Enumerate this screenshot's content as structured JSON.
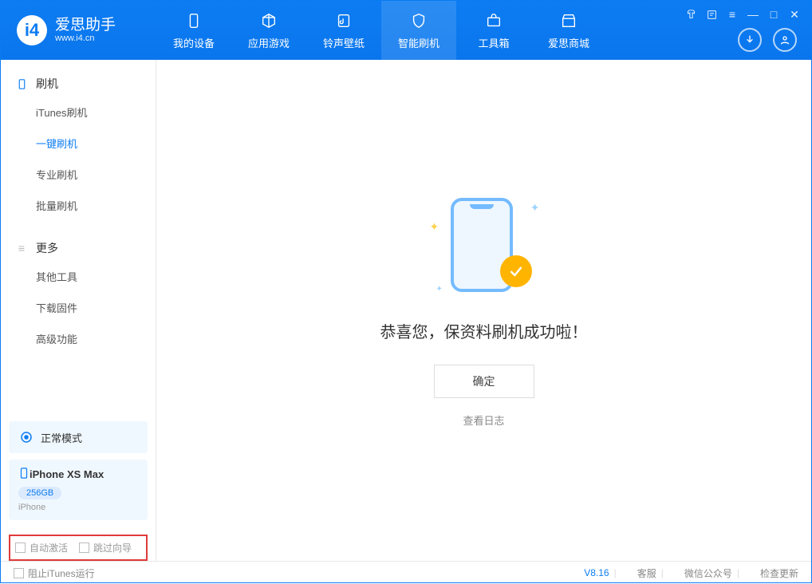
{
  "header": {
    "logo_title": "爱思助手",
    "logo_sub": "www.i4.cn",
    "tabs": [
      {
        "label": "我的设备"
      },
      {
        "label": "应用游戏"
      },
      {
        "label": "铃声壁纸"
      },
      {
        "label": "智能刷机"
      },
      {
        "label": "工具箱"
      },
      {
        "label": "爱思商城"
      }
    ]
  },
  "sidebar": {
    "section1_title": "刷机",
    "section1_items": [
      {
        "label": "iTunes刷机"
      },
      {
        "label": "一键刷机"
      },
      {
        "label": "专业刷机"
      },
      {
        "label": "批量刷机"
      }
    ],
    "section2_title": "更多",
    "section2_items": [
      {
        "label": "其他工具"
      },
      {
        "label": "下载固件"
      },
      {
        "label": "高级功能"
      }
    ],
    "mode_label": "正常模式",
    "device_name": "iPhone XS Max",
    "device_storage": "256GB",
    "device_type": "iPhone",
    "cb1_label": "自动激活",
    "cb2_label": "跳过向导"
  },
  "main": {
    "success_text": "恭喜您，保资料刷机成功啦！",
    "ok_label": "确定",
    "log_label": "查看日志"
  },
  "footer": {
    "block_itunes": "阻止iTunes运行",
    "version": "V8.16",
    "svc": "客服",
    "wechat": "微信公众号",
    "update": "检查更新"
  }
}
